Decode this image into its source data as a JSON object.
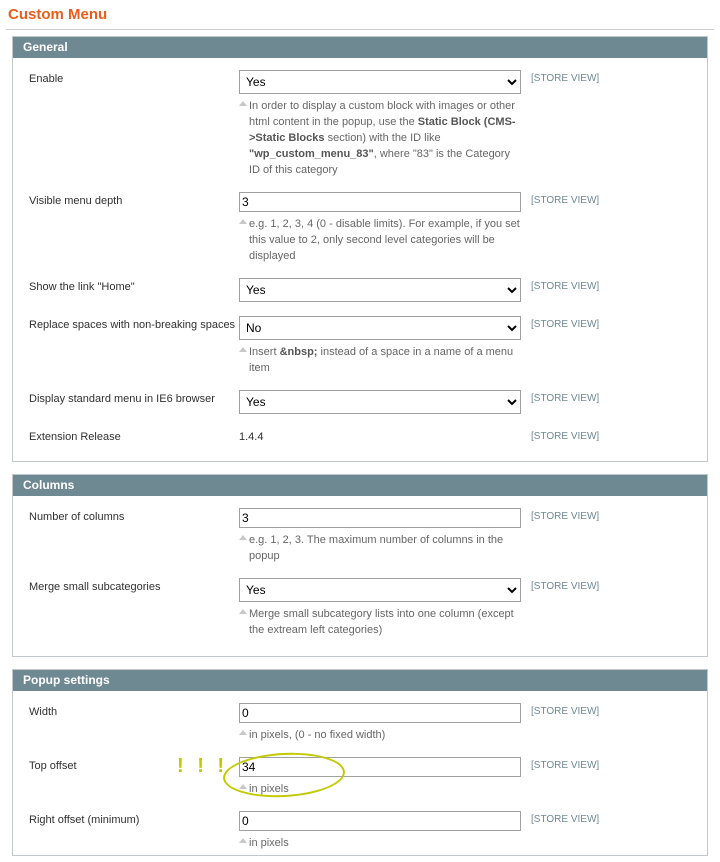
{
  "title": "Custom Menu",
  "sections": {
    "general": {
      "title": "General",
      "enable": {
        "label": "Enable",
        "value": "Yes",
        "scope": "[STORE VIEW]",
        "note_before": "In order to display a custom block with images or other html content in the popup, use the ",
        "note_strong1": "Static Block (CMS->Static Blocks",
        "note_mid": " section) with the ID like ",
        "note_strong2": "\"wp_custom_menu_83\"",
        "note_after": ", where \"83\" is the Category ID of this category"
      },
      "depth": {
        "label": "Visible menu depth",
        "value": "3",
        "scope": "[STORE VIEW]",
        "note": "e.g. 1, 2, 3, 4 (0 - disable limits). For example, if you set this value to 2, only second level categories will be displayed"
      },
      "home": {
        "label": "Show the link \"Home\"",
        "value": "Yes",
        "scope": "[STORE VIEW]"
      },
      "nbsp": {
        "label": "Replace spaces with non-breaking spaces",
        "value": "No",
        "scope": "[STORE VIEW]",
        "note_before": "Insert ",
        "note_strong": "&nbsp;",
        "note_after": " instead of a space in a name of a menu item"
      },
      "ie6": {
        "label": "Display standard menu in IE6 browser",
        "value": "Yes",
        "scope": "[STORE VIEW]"
      },
      "release": {
        "label": "Extension Release",
        "value": "1.4.4",
        "scope": "[STORE VIEW]"
      }
    },
    "columns": {
      "title": "Columns",
      "num": {
        "label": "Number of columns",
        "value": "3",
        "scope": "[STORE VIEW]",
        "note": "e.g. 1, 2, 3. The maximum number of columns in the popup"
      },
      "merge": {
        "label": "Merge small subcategories",
        "value": "Yes",
        "scope": "[STORE VIEW]",
        "note": "Merge small subcategory lists into one column (except the extream left categories)"
      }
    },
    "popup": {
      "title": "Popup settings",
      "width": {
        "label": "Width",
        "value": "0",
        "scope": "[STORE VIEW]",
        "note": "in pixels, (0 - no fixed width)"
      },
      "top": {
        "label": "Top offset",
        "value": "34",
        "scope": "[STORE VIEW]",
        "note": "in pixels",
        "annot": "! ! !"
      },
      "right": {
        "label": "Right offset (minimum)",
        "value": "0",
        "scope": "[STORE VIEW]",
        "note": "in pixels"
      }
    }
  }
}
